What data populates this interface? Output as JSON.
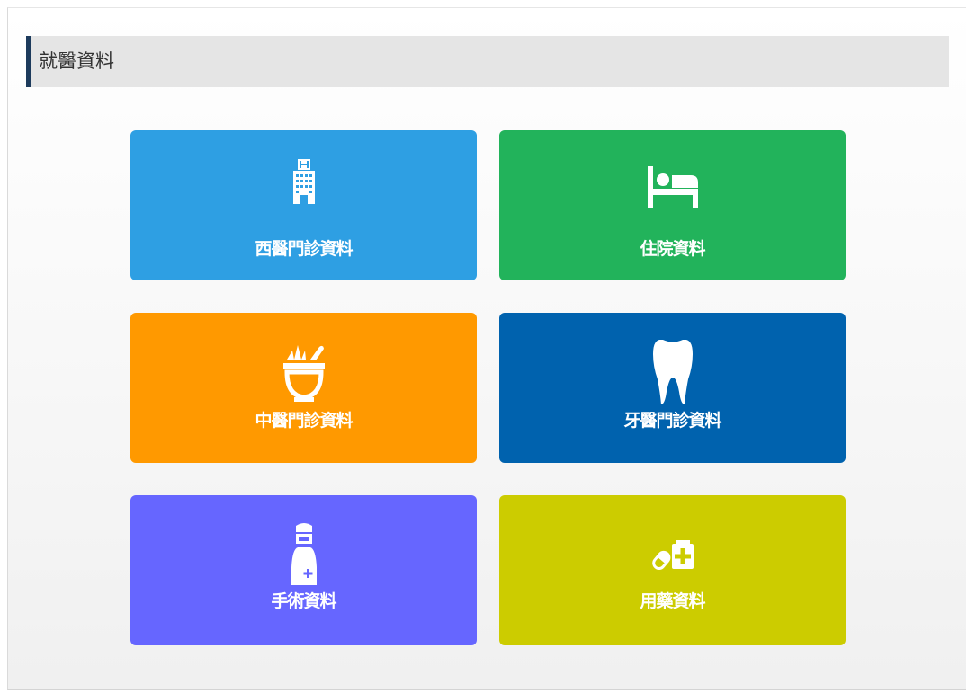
{
  "section": {
    "title": "就醫資料"
  },
  "tiles": [
    {
      "label": "西醫門診資料",
      "icon": "hospital-building-icon",
      "color": "#2e9fe3"
    },
    {
      "label": "住院資料",
      "icon": "hospital-bed-icon",
      "color": "#22b35b"
    },
    {
      "label": "中醫門診資料",
      "icon": "herbal-mortar-icon",
      "color": "#ff9900"
    },
    {
      "label": "牙醫門診資料",
      "icon": "tooth-icon",
      "color": "#0062ae"
    },
    {
      "label": "手術資料",
      "icon": "surgeon-icon",
      "color": "#6666ff"
    },
    {
      "label": "用藥資料",
      "icon": "medicine-pill-icon",
      "color": "#cccc00"
    }
  ]
}
